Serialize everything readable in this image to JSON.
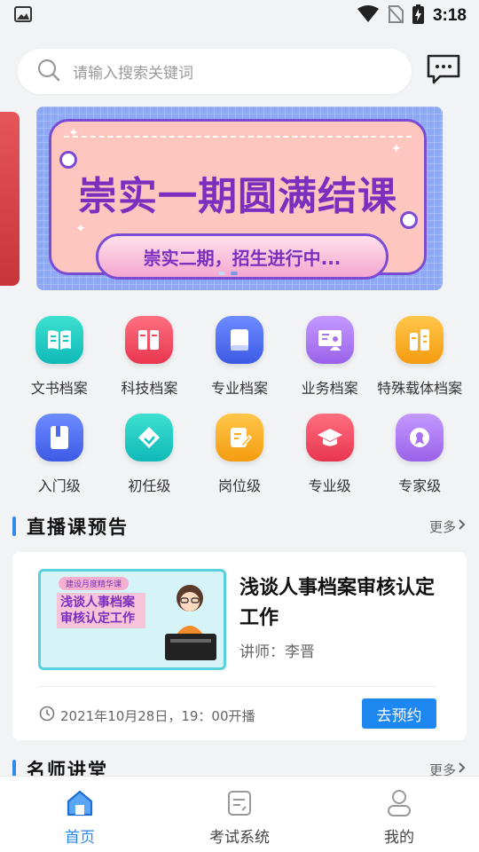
{
  "status_bar": {
    "time": "3:18"
  },
  "search": {
    "placeholder": "请输入搜索关键词"
  },
  "banner": {
    "title": "崇实一期圆满结课",
    "subtitle": "崇实二期，招生进行中..."
  },
  "categories": [
    {
      "label": "文书档案",
      "icon": "book-icon",
      "color": "#16c6c0"
    },
    {
      "label": "科技档案",
      "icon": "binders-icon",
      "color": "#f0455c"
    },
    {
      "label": "专业档案",
      "icon": "notebook-icon",
      "color": "#4b6cf0"
    },
    {
      "label": "业务档案",
      "icon": "presentation-icon",
      "color": "#a872ee"
    },
    {
      "label": "特殊载体档案",
      "icon": "file-cabinet-icon",
      "color": "#f8ac1f"
    },
    {
      "label": "入门级",
      "icon": "folder-icon",
      "color": "#4b6cf0"
    },
    {
      "label": "初任级",
      "icon": "tag-icon",
      "color": "#16c6c0"
    },
    {
      "label": "岗位级",
      "icon": "edit-doc-icon",
      "color": "#f8ac1f"
    },
    {
      "label": "专业级",
      "icon": "graduation-cap-icon",
      "color": "#f0455c"
    },
    {
      "label": "专家级",
      "icon": "medal-icon",
      "color": "#a872ee"
    }
  ],
  "live_section": {
    "title": "直播课预告",
    "more": "更多",
    "course": {
      "thumb_tag": "建设月度精华课",
      "thumb_text": "浅谈人事档案审核认定工作",
      "title": "浅谈人事档案审核认定工作",
      "lecturer": "讲师：李晋",
      "time": "2021年10月28日，19：00开播",
      "button": "去预约"
    }
  },
  "teacher_section": {
    "title": "名师讲堂",
    "more": "更多"
  },
  "tabs": [
    {
      "label": "首页",
      "icon": "home-icon",
      "active": true
    },
    {
      "label": "考试系统",
      "icon": "exam-icon",
      "active": false
    },
    {
      "label": "我的",
      "icon": "profile-icon",
      "active": false
    }
  ],
  "colors": {
    "accent": "#2a86ef",
    "button": "#1e88f0",
    "section_bar": "#2f87f0"
  }
}
